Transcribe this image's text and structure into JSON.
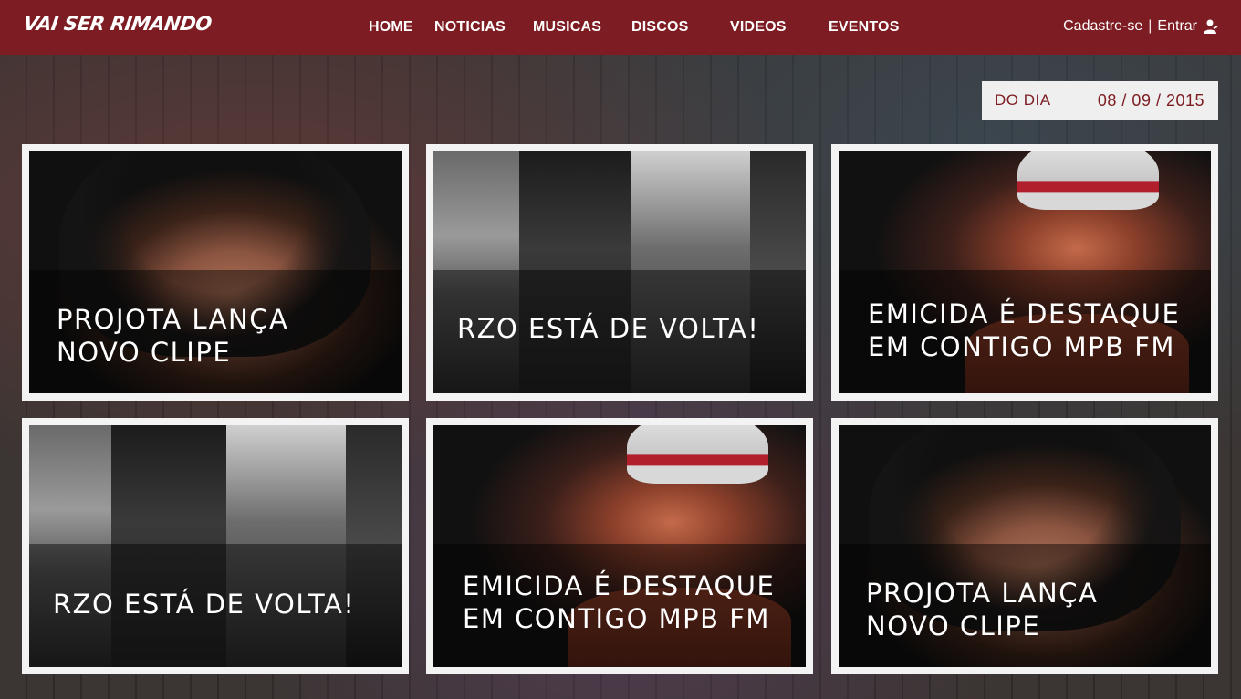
{
  "header": {
    "logo_text": "VAI SER RIMANDO",
    "nav": [
      "HOME",
      "NOTICIAS",
      "MUSICAS",
      "DISCOS",
      "VIDEOS",
      "EVENTOS"
    ],
    "auth": {
      "register": "Cadastre-se",
      "separator": "|",
      "login": "Entrar",
      "icon": "user-icon"
    },
    "color": "#7d1c22"
  },
  "date_box": {
    "label": "DO DIA",
    "value": "08 / 09 / 2015"
  },
  "cards": [
    {
      "title_line1": "PROJOTA LANÇA",
      "title_line2": "NOVO CLIPE",
      "image": "projota-photo"
    },
    {
      "title_line1": "RZO ESTÁ DE VOLTA!",
      "title_line2": "",
      "image": "rzo-group-photo"
    },
    {
      "title_line1": "EMICIDA É DESTAQUE",
      "title_line2": "EM CONTIGO MPB FM",
      "image": "emicida-photo"
    },
    {
      "title_line1": "RZO ESTÁ DE VOLTA!",
      "title_line2": "",
      "image": "rzo-group-photo"
    },
    {
      "title_line1": "EMICIDA É DESTAQUE",
      "title_line2": "EM CONTIGO MPB FM",
      "image": "emicida-photo"
    },
    {
      "title_line1": "PROJOTA LANÇA",
      "title_line2": "NOVO CLIPE",
      "image": "projota-photo"
    }
  ]
}
